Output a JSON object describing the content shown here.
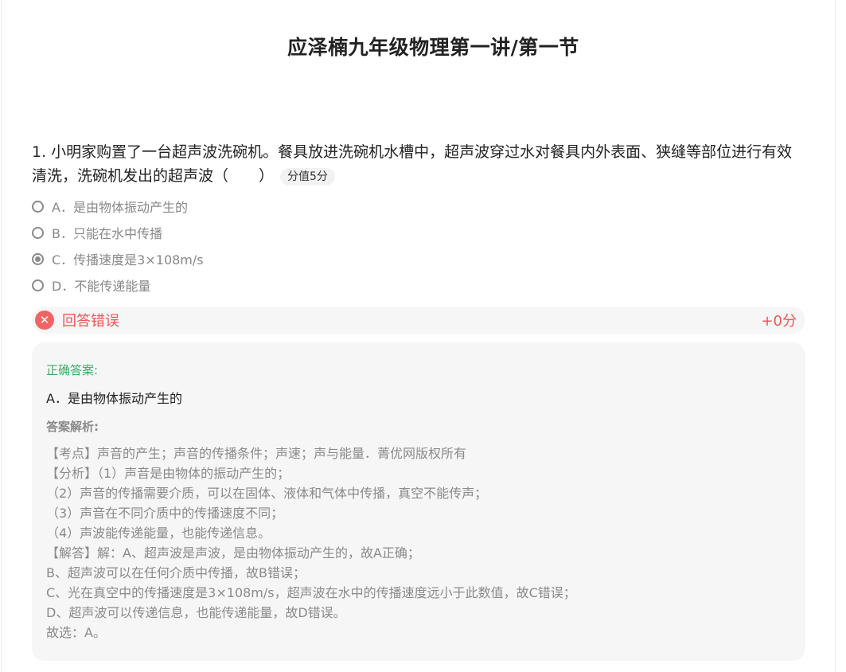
{
  "page": {
    "title": "应泽楠九年级物理第一讲/第一节"
  },
  "question": {
    "text": "1. 小明家购置了一台超声波洗碗机。餐具放进洗碗机水槽中，超声波穿过水对餐具内外表面、狭缝等部位进行有效清洗，洗碗机发出的超声波（　　）",
    "score_label": "分值5分",
    "options": [
      {
        "label": "A．是由物体振动产生的",
        "selected": false
      },
      {
        "label": "B．只能在水中传播",
        "selected": false
      },
      {
        "label": "C．传播速度是3×108m/s",
        "selected": true
      },
      {
        "label": "D．不能传递能量",
        "selected": false
      }
    ]
  },
  "result": {
    "icon": "close-circle-icon",
    "label": "回答错误",
    "score": "+0分",
    "color": "#ee5555"
  },
  "answer": {
    "title": "正确答案:",
    "value": "A．是由物体振动产生的",
    "analysis_title": "答案解析:",
    "analysis_lines": [
      "【考点】声音的产生；声音的传播条件；声速；声与能量．菁优网版权所有",
      "【分析】（1）声音是由物体的振动产生的；",
      "（2）声音的传播需要介质，可以在固体、液体和气体中传播，真空不能传声；",
      "（3）声音在不同介质中的传播速度不同；",
      "（4）声波能传递能量，也能传递信息。",
      "【解答】解：A、超声波是声波，是由物体振动产生的，故A正确；",
      "B、超声波可以在任何介质中传播，故B错误；",
      "C、光在真空中的传播速度是3×108m/s，超声波在水中的传播速度远小于此数值，故C错误；",
      "D、超声波可以传递信息，也能传递能量，故D错误。",
      "故选：A。"
    ]
  }
}
